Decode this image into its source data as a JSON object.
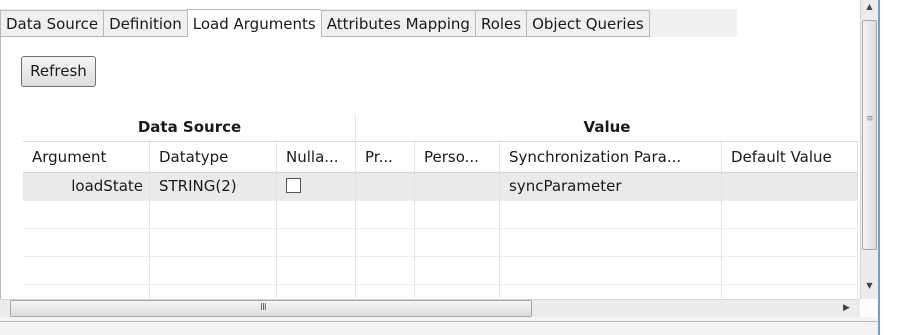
{
  "tabs": [
    {
      "label": "Data Source",
      "active": false
    },
    {
      "label": "Definition",
      "active": false
    },
    {
      "label": "Load Arguments",
      "active": true
    },
    {
      "label": "Attributes Mapping",
      "active": false
    },
    {
      "label": "Roles",
      "active": false
    },
    {
      "label": "Object Queries",
      "active": false
    }
  ],
  "toolbar": {
    "refresh_label": "Refresh"
  },
  "grid": {
    "groups": [
      "Data Source",
      "Value"
    ],
    "columns": [
      "Argument",
      "Datatype",
      "Nulla...",
      "Pr...",
      "Perso...",
      "Synchronization Para...",
      "Default Value"
    ],
    "rows": [
      {
        "argument": "loadState",
        "datatype": "STRING(2)",
        "nullable": false,
        "pr": "",
        "perso": "",
        "sync_param": "syncParameter",
        "default_value": ""
      }
    ]
  },
  "scrollbars": {
    "horizontal_grip": "III",
    "vertical_grip": "≡"
  },
  "colors": {
    "accent_border": "#7a9bc6",
    "tab_border": "#b9b9b9",
    "selected_row": "#eaeaea"
  }
}
